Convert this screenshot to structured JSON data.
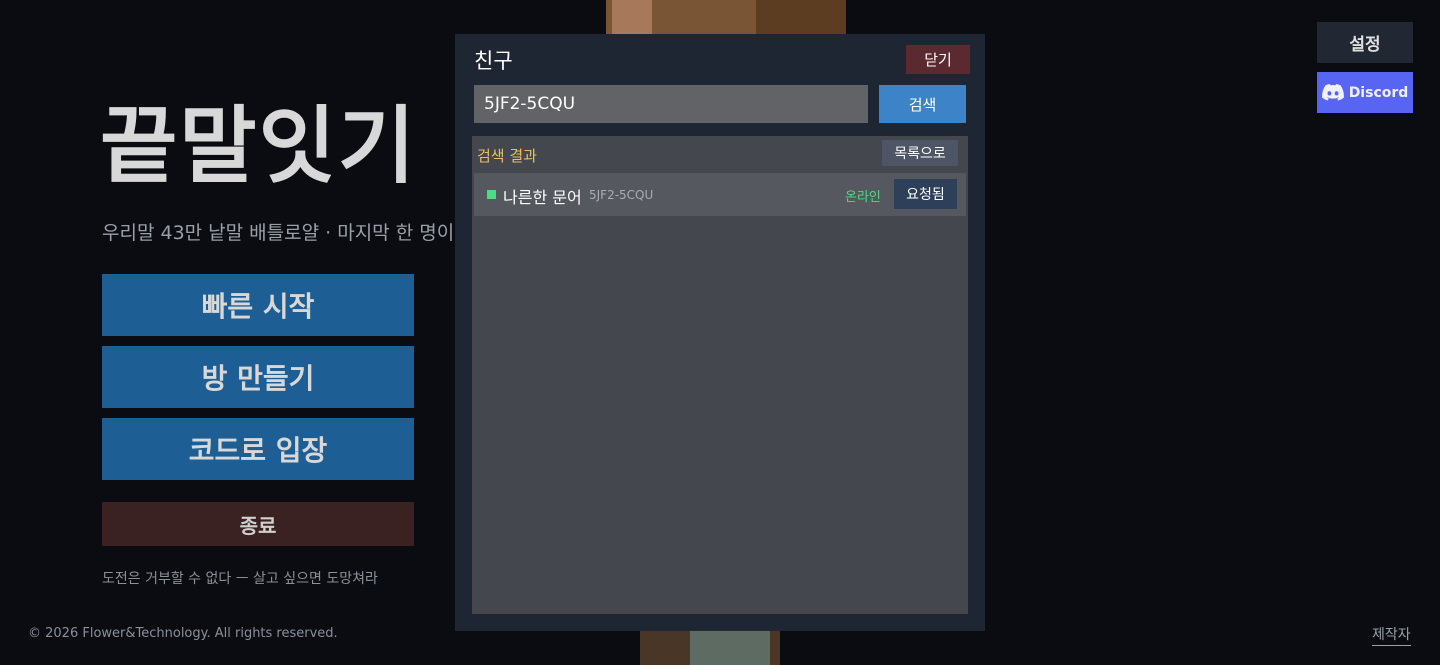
{
  "game": {
    "title": "끝말잇기",
    "subtitle": "우리말 43만 낱말 배틀로얄 · 마지막 한 명이",
    "tagline": "도전은 거부할 수 없다 ㅡ 살고 싶으면 도망쳐라",
    "copyright": "© 2026 Flower&Technology. All rights reserved.",
    "credits_label": "제작자"
  },
  "menu": {
    "quick_start": "빠른 시작",
    "create_room": "방 만들기",
    "join_code": "코드로 입장",
    "exit": "종료"
  },
  "top_right": {
    "settings_label": "설정",
    "discord_label": "Discord",
    "discord_icon": "discord-icon"
  },
  "friends_modal": {
    "title": "친구",
    "close_label": "닫기",
    "search_value": "5JF2-5CQU",
    "search_button": "검색",
    "results_title": "검색 결과",
    "back_to_list_label": "목록으로",
    "results": [
      {
        "name": "나른한 문어",
        "code": "5JF2-5CQU",
        "status": "온라인",
        "action_label": "요청됨"
      }
    ]
  },
  "colors": {
    "accent_blue": "#1d5f94",
    "online_green": "#4ade80",
    "results_title_yellow": "#e8c060",
    "discord_purple": "#5865f2",
    "close_red": "#5a2a30"
  }
}
